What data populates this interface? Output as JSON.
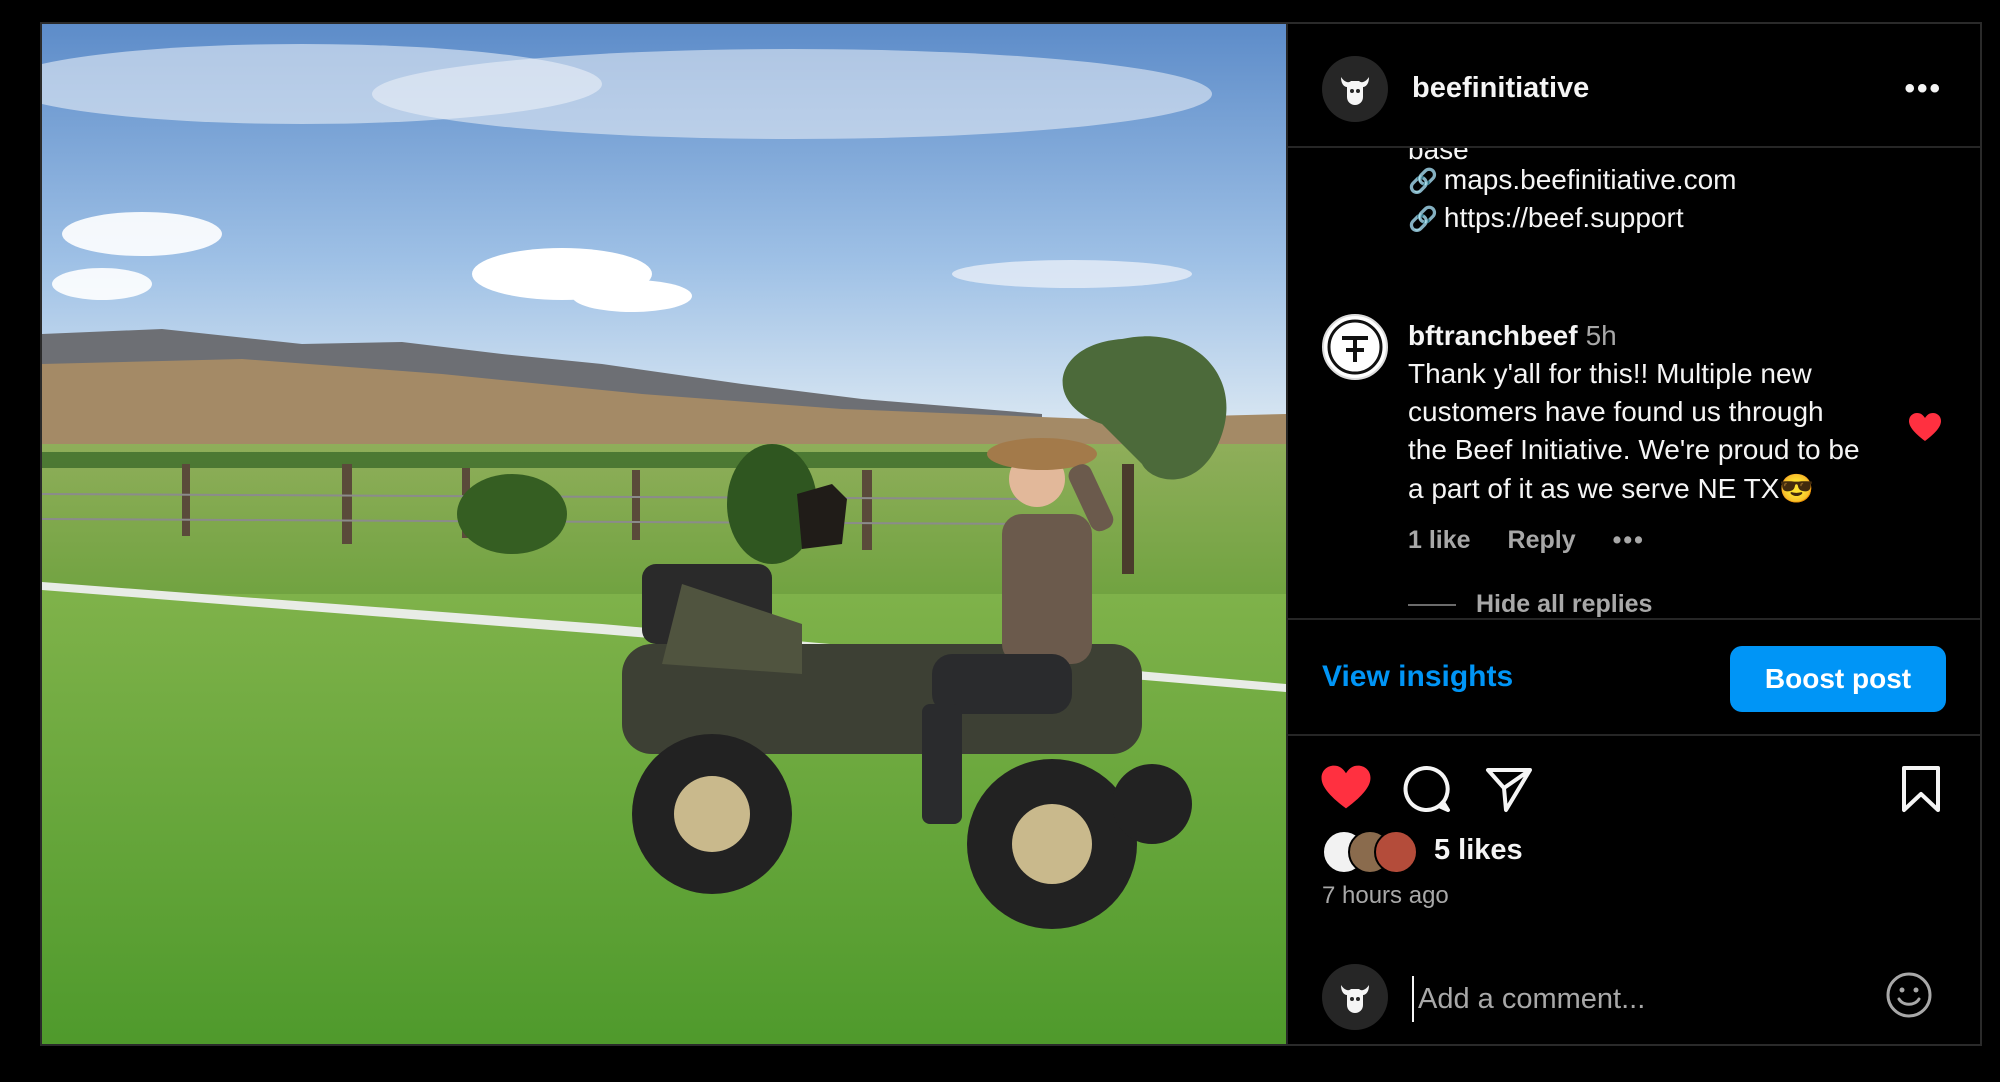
{
  "post": {
    "owner": "beefinitiative",
    "more_label": "•••"
  },
  "caption": {
    "partial_line": "base",
    "links": [
      "maps.beefinitiative.com",
      "https://beef.support"
    ]
  },
  "comment": {
    "user": "bftranchbeef",
    "time": "5h",
    "lines": [
      "Thank y'all for this!! Multiple new",
      "customers have found us through",
      "the Beef Initiative. We're proud to be",
      "a part of it as we serve NE TX😎"
    ],
    "likes": "1 like",
    "reply": "Reply",
    "more": "•••",
    "hide_replies": "Hide all replies"
  },
  "insights": {
    "view_insights": "View insights",
    "boost_post": "Boost post"
  },
  "engagement": {
    "likes": "5 likes",
    "time_ago": "7 hours ago"
  },
  "composer": {
    "placeholder": "Add a comment..."
  },
  "colors": {
    "accent": "#0095f6",
    "like_red": "#ff3040",
    "background": "#000000"
  },
  "icons": [
    "like-icon",
    "comment-icon",
    "share-icon",
    "save-icon",
    "emoji-icon",
    "link-icon"
  ]
}
